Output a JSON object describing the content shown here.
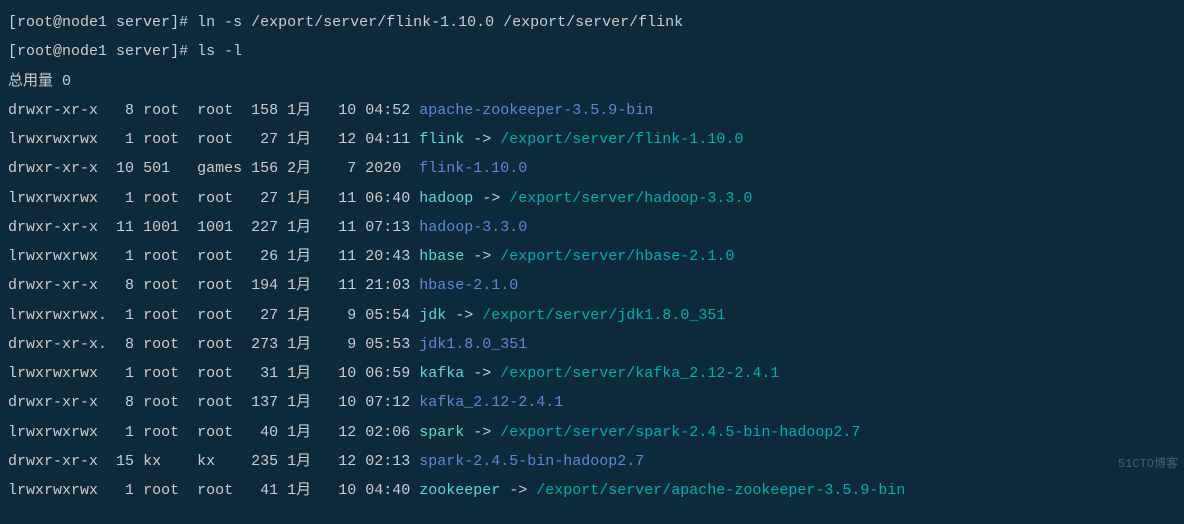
{
  "prompt": {
    "user": "root",
    "host": "node1",
    "cwd": "server",
    "marker": "#"
  },
  "commands": [
    "ln -s /export/server/flink-1.10.0 /export/server/flink",
    "ls -l"
  ],
  "total_line": "总用量 0",
  "entries": [
    {
      "perm": "drwxr-xr-x",
      "links": "8",
      "user": "root",
      "group": "root",
      "size": "158",
      "month": "1月",
      "day": "10",
      "time": "04:52",
      "name": "apache-zookeeper-3.5.9-bin",
      "name_color": "blue",
      "target": null
    },
    {
      "perm": "lrwxrwxrwx",
      "links": "1",
      "user": "root",
      "group": "root",
      "size": "27",
      "month": "1月",
      "day": "12",
      "time": "04:11",
      "name": "flink",
      "name_color": "cyan",
      "target": "/export/server/flink-1.10.0",
      "target_color": "teal"
    },
    {
      "perm": "drwxr-xr-x",
      "links": "10",
      "user": "501",
      "group": "games",
      "size": "156",
      "month": "2月",
      "day": "7",
      "time": "2020",
      "name": "flink-1.10.0",
      "name_color": "blue",
      "target": null
    },
    {
      "perm": "lrwxrwxrwx",
      "links": "1",
      "user": "root",
      "group": "root",
      "size": "27",
      "month": "1月",
      "day": "11",
      "time": "06:40",
      "name": "hadoop",
      "name_color": "cyan",
      "target": "/export/server/hadoop-3.3.0",
      "target_color": "teal"
    },
    {
      "perm": "drwxr-xr-x",
      "links": "11",
      "user": "1001",
      "group": "1001",
      "size": "227",
      "month": "1月",
      "day": "11",
      "time": "07:13",
      "name": "hadoop-3.3.0",
      "name_color": "blue",
      "target": null
    },
    {
      "perm": "lrwxrwxrwx",
      "links": "1",
      "user": "root",
      "group": "root",
      "size": "26",
      "month": "1月",
      "day": "11",
      "time": "20:43",
      "name": "hbase",
      "name_color": "cyan",
      "target": "/export/server/hbase-2.1.0",
      "target_color": "teal"
    },
    {
      "perm": "drwxr-xr-x",
      "links": "8",
      "user": "root",
      "group": "root",
      "size": "194",
      "month": "1月",
      "day": "11",
      "time": "21:03",
      "name": "hbase-2.1.0",
      "name_color": "blue",
      "target": null
    },
    {
      "perm": "lrwxrwxrwx.",
      "links": "1",
      "user": "root",
      "group": "root",
      "size": "27",
      "month": "1月",
      "day": "9",
      "time": "05:54",
      "name": "jdk",
      "name_color": "cyan",
      "target": "/export/server/jdk1.8.0_351",
      "target_color": "teal"
    },
    {
      "perm": "drwxr-xr-x.",
      "links": "8",
      "user": "root",
      "group": "root",
      "size": "273",
      "month": "1月",
      "day": "9",
      "time": "05:53",
      "name": "jdk1.8.0_351",
      "name_color": "blue",
      "target": null
    },
    {
      "perm": "lrwxrwxrwx",
      "links": "1",
      "user": "root",
      "group": "root",
      "size": "31",
      "month": "1月",
      "day": "10",
      "time": "06:59",
      "name": "kafka",
      "name_color": "cyan",
      "target": "/export/server/kafka_2.12-2.4.1",
      "target_color": "teal"
    },
    {
      "perm": "drwxr-xr-x",
      "links": "8",
      "user": "root",
      "group": "root",
      "size": "137",
      "month": "1月",
      "day": "10",
      "time": "07:12",
      "name": "kafka_2.12-2.4.1",
      "name_color": "blue",
      "target": null
    },
    {
      "perm": "lrwxrwxrwx",
      "links": "1",
      "user": "root",
      "group": "root",
      "size": "40",
      "month": "1月",
      "day": "12",
      "time": "02:06",
      "name": "spark",
      "name_color": "cyan",
      "target": "/export/server/spark-2.4.5-bin-hadoop2.7",
      "target_color": "teal"
    },
    {
      "perm": "drwxr-xr-x",
      "links": "15",
      "user": "kx",
      "group": "kx",
      "size": "235",
      "month": "1月",
      "day": "12",
      "time": "02:13",
      "name": "spark-2.4.5-bin-hadoop2.7",
      "name_color": "blue",
      "target": null
    },
    {
      "perm": "lrwxrwxrwx",
      "links": "1",
      "user": "root",
      "group": "root",
      "size": "41",
      "month": "1月",
      "day": "10",
      "time": "04:40",
      "name": "zookeeper",
      "name_color": "cyan",
      "target": "/export/server/apache-zookeeper-3.5.9-bin",
      "target_color": "teal"
    }
  ],
  "watermark": "51CTO博客"
}
